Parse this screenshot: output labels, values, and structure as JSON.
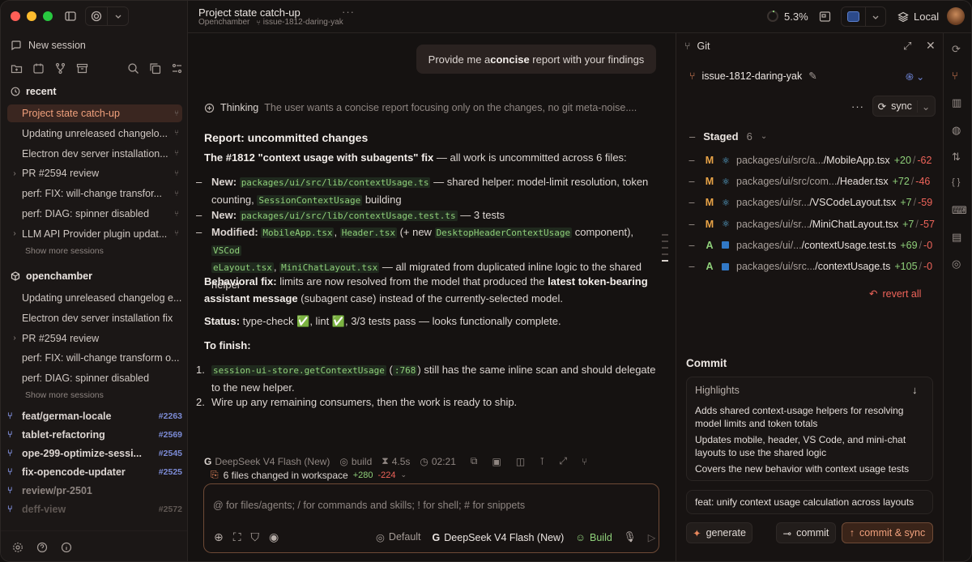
{
  "window": {
    "title": "Project state catch-up",
    "project": "Openchamber",
    "branch": "issue-1812-daring-yak"
  },
  "topbar": {
    "context_usage": "5.3%",
    "runtime": "Local"
  },
  "sidebar": {
    "new_session": "New session",
    "recent_title": "recent",
    "recent": [
      {
        "label": "Project state catch-up",
        "active": true,
        "expandable": false
      },
      {
        "label": "Updating unreleased changelo...",
        "active": false,
        "expandable": false
      },
      {
        "label": "Electron dev server installation...",
        "active": false,
        "expandable": false
      },
      {
        "label": "PR #2594 review",
        "active": false,
        "expandable": true
      },
      {
        "label": "perf: FIX: will-change transfor...",
        "active": false,
        "expandable": false
      },
      {
        "label": "perf: DIAG: spinner disabled",
        "active": false,
        "expandable": false
      },
      {
        "label": "LLM API Provider plugin updat...",
        "active": false,
        "expandable": true
      }
    ],
    "show_more": "Show more sessions",
    "project_title": "openchamber",
    "project_sessions": [
      {
        "label": "Updating unreleased changelog e...",
        "expandable": false
      },
      {
        "label": "Electron dev server installation fix",
        "expandable": false
      },
      {
        "label": "PR #2594 review",
        "expandable": true
      },
      {
        "label": "perf: FIX: will-change transform o...",
        "expandable": false
      },
      {
        "label": "perf: DIAG: spinner disabled",
        "expandable": false
      }
    ],
    "show_more2": "Show more sessions",
    "worktrees": [
      {
        "label": "feat/german-locale",
        "num": "#2263"
      },
      {
        "label": "tablet-refactoring",
        "num": "#2569"
      },
      {
        "label": "ope-299-optimize-sessi...",
        "num": "#2545"
      },
      {
        "label": "fix-opencode-updater",
        "num": "#2525"
      },
      {
        "label": "review/pr-2501",
        "num": ""
      },
      {
        "label": "deff-view",
        "num": "#2572"
      }
    ]
  },
  "chat": {
    "user_message_pre": "Provide me a ",
    "user_message_bold": "concise",
    "user_message_post": " report with your findings",
    "thinking_label": "Thinking",
    "thinking_text": "The user wants a concise report focusing only on the changes, no git meta-noise....",
    "report_title": "Report: uncommitted changes",
    "fix_title": "The #1812 \"context usage with subagents\" fix",
    "fix_desc": " — all work is uncommitted across 6 files:",
    "b1_label": "New:",
    "b1_code": "packages/ui/src/lib/contextUsage.ts",
    "b1_text1": " — shared helper: model-limit resolution, token",
    "b1_text2": "counting, ",
    "b1_code2": "SessionContextUsage",
    "b1_text3": " building",
    "b2_label": "New:",
    "b2_code": "packages/ui/src/lib/contextUsage.test.ts",
    "b2_text": " — 3 tests",
    "b3_label": "Modified:",
    "b3_c1": "MobileApp.tsx",
    "b3_c2": "Header.tsx",
    "b3_t1": " (+ new ",
    "b3_c3": "DesktopHeaderContextUsage",
    "b3_t2": " component), ",
    "b3_c4a": "VSCod",
    "b3_c4b": "eLayout.tsx",
    "b3_c5": "MiniChatLayout.tsx",
    "b3_t3": " — all migrated from duplicated inline logic to the shared",
    "b3_t4": "helper",
    "behav_label": "Behavioral fix:",
    "behav_text": " limits are now resolved from the model that produced the ",
    "behav_bold": "latest token-bearing",
    "behav_bold2": "assistant message",
    "behav_text2": " (subagent case) instead of the currently-selected model.",
    "status_label": "Status:",
    "status_text": " type-check ✅, lint ✅, 3/3 tests pass — looks functionally complete.",
    "finish_title": "To finish:",
    "f1_code": "session-ui-store.getContextUsage",
    "f1_t1": " (",
    "f1_code2": ":768",
    "f1_t2": ") still has the same inline scan and should delegate",
    "f1_t3": "to the new helper.",
    "f2": "Wire up any remaining consumers, then the work is ready to ship.",
    "meta_model": "DeepSeek V4 Flash (New)",
    "meta_mode": "build",
    "meta_duration": "4.5s",
    "meta_time": "02:21",
    "changes_label": "6 files changed in workspace",
    "changes_add": "+280",
    "changes_del": "-224",
    "input_placeholder": "@ for files/agents; / for commands and skills; ! for shell; # for snippets",
    "input_variant": "Default",
    "input_model": "DeepSeek V4 Flash (New)",
    "input_mode": "Build"
  },
  "git": {
    "title": "Git",
    "branch": "issue-1812-daring-yak",
    "sync": "sync",
    "staged_label": "Staged",
    "staged_count": "6",
    "files": [
      {
        "mark": "M",
        "icon": "react",
        "path": "packages/ui/src/a...",
        "file": "/MobileApp.tsx",
        "add": "+20",
        "del": "-62"
      },
      {
        "mark": "M",
        "icon": "react",
        "path": "packages/ui/src/com...",
        "file": "/Header.tsx",
        "add": "+72",
        "del": "-46"
      },
      {
        "mark": "M",
        "icon": "react",
        "path": "packages/ui/sr...",
        "file": "/VSCodeLayout.tsx",
        "add": "+7",
        "del": "-59"
      },
      {
        "mark": "M",
        "icon": "react",
        "path": "packages/ui/sr...",
        "file": "/MiniChatLayout.tsx",
        "add": "+7",
        "del": "-57"
      },
      {
        "mark": "A",
        "icon": "ts",
        "path": "packages/ui/...",
        "file": "/contextUsage.test.ts",
        "add": "+69",
        "del": "-0"
      },
      {
        "mark": "A",
        "icon": "ts",
        "path": "packages/ui/src...",
        "file": "/contextUsage.ts",
        "add": "+105",
        "del": "-0"
      }
    ],
    "revert_all": "revert all",
    "commit_title": "Commit",
    "highlights_title": "Highlights",
    "highlights": [
      "Adds shared context-usage helpers for resolving model limits and token totals",
      "Updates mobile, header, VS Code, and mini-chat layouts to use the shared logic",
      "Covers the new behavior with context usage tests"
    ],
    "commit_message": "feat: unify context usage calculation across layouts",
    "generate": "generate",
    "commit": "commit",
    "commit_sync": "commit & sync"
  },
  "colors": {
    "accent": "#e8875c",
    "added": "#8fd07a",
    "deleted": "#f0645a",
    "branch": "#7c8bd6"
  }
}
